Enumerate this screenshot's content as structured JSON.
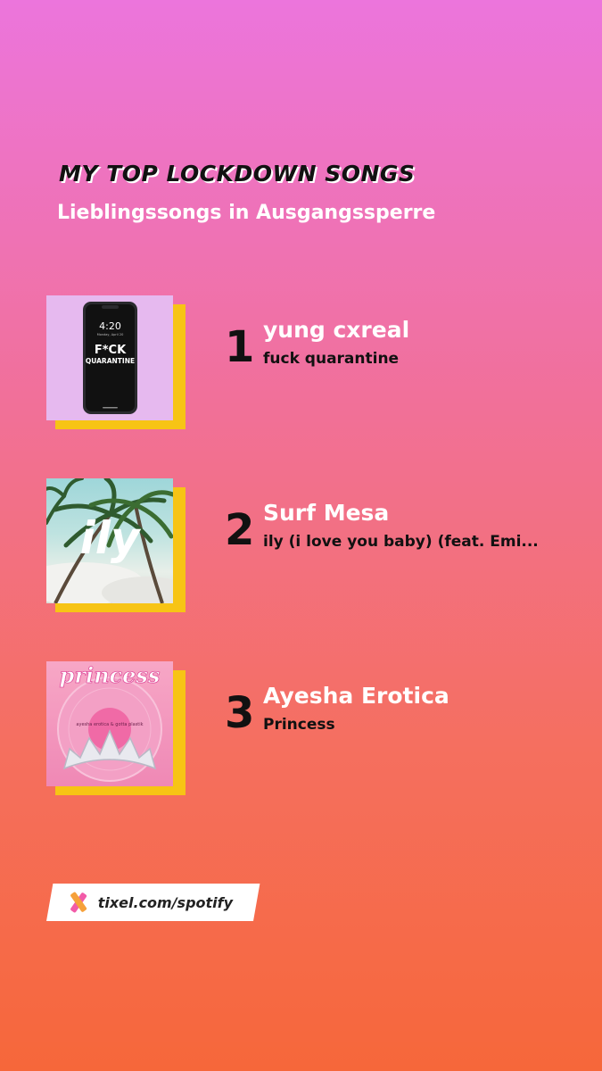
{
  "header": {
    "title": "MY TOP LOCKDOWN SONGS",
    "subtitle": "Lieblingssongs in Ausgangssperre"
  },
  "tracks": [
    {
      "rank": "1",
      "artist": "yung cxreal",
      "song": "fuck quarantine",
      "cover": {
        "time": "4:20",
        "date": "Monday, April 20",
        "line1": "F*CK",
        "line2": "QUARANTINE"
      }
    },
    {
      "rank": "2",
      "artist": "Surf Mesa",
      "song": "ily (i love you baby) (feat. Emi...",
      "cover": {
        "text": "ily"
      }
    },
    {
      "rank": "3",
      "artist": "Ayesha Erotica",
      "song": "Princess",
      "cover": {
        "title": "princess",
        "label": "ayesha erotica & gotta plastik"
      }
    }
  ],
  "footer": {
    "link": "tixel.com/spotify",
    "icon": "tixel-logo-icon"
  },
  "colors": {
    "gradient_top": "#ec75dc",
    "gradient_bottom": "#f6673a",
    "accent": "#f7c415"
  }
}
